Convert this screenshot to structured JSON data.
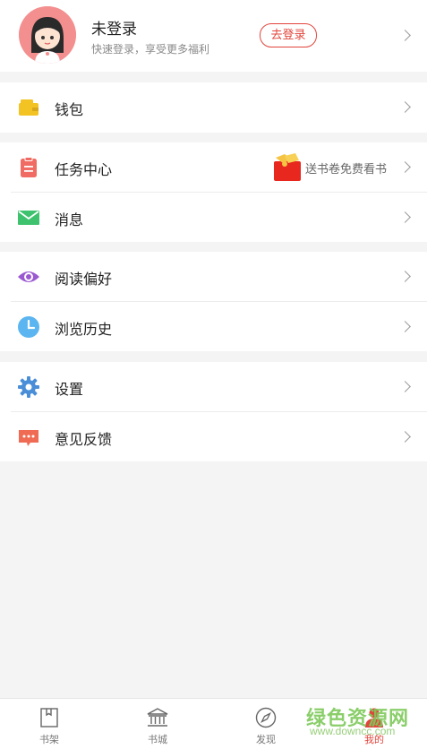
{
  "header": {
    "user_name": "未登录",
    "user_sub": "快速登录，享受更多福利",
    "login_label": "去登录"
  },
  "menu": {
    "wallet": "钱包",
    "tasks": "任务中心",
    "tasks_badge": "送书卷免费看书",
    "messages": "消息",
    "reading_pref": "阅读偏好",
    "history": "浏览历史",
    "settings": "设置",
    "feedback": "意见反馈"
  },
  "tabs": [
    {
      "label": "书架"
    },
    {
      "label": "书城"
    },
    {
      "label": "发现"
    },
    {
      "label": "我的"
    }
  ],
  "watermark": {
    "text": "绿色资源网",
    "url": "www.downcc.com"
  },
  "colors": {
    "accent": "#e2453c",
    "wallet": "#f2c323",
    "tasks": "#f06b63",
    "messages": "#3fc26e",
    "reading_pref": "#9b59d1",
    "history": "#5bb5f0",
    "settings": "#4a8ed8",
    "feedback": "#f06b53"
  }
}
